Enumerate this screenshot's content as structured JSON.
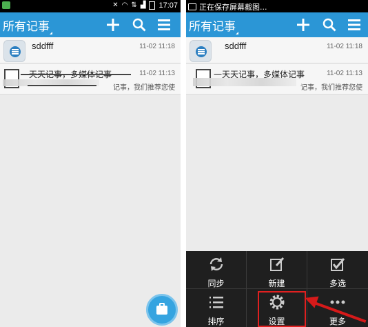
{
  "left_screen": {
    "status_bar": {
      "time": "17:07"
    },
    "action_bar": {
      "title": "所有记事"
    },
    "notes": [
      {
        "title": "sddfff",
        "date": "11-02 11:18"
      },
      {
        "title": "一天天记事，多媒体记事",
        "date": "11-02 11:13",
        "snippet": "记事，我们推荐您使"
      }
    ]
  },
  "right_screen": {
    "status_bar": {
      "notice": "正在保存屏幕截图..."
    },
    "action_bar": {
      "title": "所有记事"
    },
    "notes": [
      {
        "title": "sddfff",
        "date": "11-02 11:18"
      },
      {
        "title": "一天天记事，多媒体记事",
        "date": "11-02 11:13",
        "snippet": "记事，我们推荐您使"
      }
    ],
    "menu": {
      "items": [
        {
          "label": "同步",
          "icon": "sync-icon"
        },
        {
          "label": "新建",
          "icon": "new-note-icon"
        },
        {
          "label": "多选",
          "icon": "multi-select-icon"
        },
        {
          "label": "排序",
          "icon": "sort-icon"
        },
        {
          "label": "设置",
          "icon": "settings-icon"
        },
        {
          "label": "更多",
          "icon": "more-icon"
        }
      ]
    }
  },
  "colors": {
    "action_bar": "#2b96d6",
    "list_bg": "#ebebeb",
    "menu_bg": "#1f1f1f",
    "highlight": "#e02020"
  }
}
